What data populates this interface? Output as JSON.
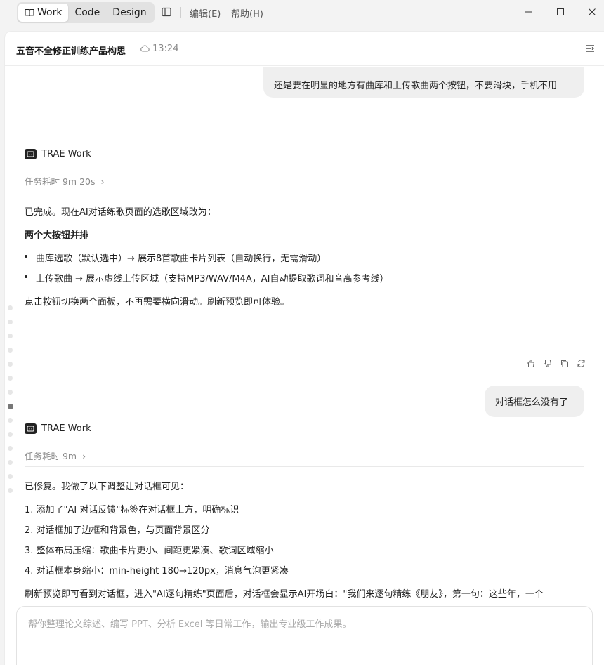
{
  "titlebar": {
    "modes": [
      "Work",
      "Code",
      "Design"
    ],
    "active_mode": "Work",
    "menus": [
      "编辑(E)",
      "帮助(H)"
    ]
  },
  "header": {
    "title": "五音不全修正训练产品构思",
    "time": "13:24"
  },
  "messages": {
    "user1": "还是要在明显的地方有曲库和上传歌曲两个按钮，不要滑块，手机不用",
    "agent1": {
      "name": "TRAE Work",
      "task_time": "任务耗时 9m 20s",
      "intro": "已完成。现在AI对话练歌页面的选歌区域改为：",
      "heading": "两个大按钮并排",
      "bullets": [
        "曲库选歌（默认选中）→ 展示8首歌曲卡片列表（自动换行，无需滑动）",
        "上传歌曲 → 展示虚线上传区域（支持MP3/WAV/M4A，AI自动提取歌词和音高参考线）"
      ],
      "outro": "点击按钮切换两个面板，不再需要横向滑动。刷新预览即可体验。"
    },
    "user2": "对话框怎么没有了",
    "agent2": {
      "name": "TRAE Work",
      "task_time": "任务耗时 9m",
      "intro": "已修复。我做了以下调整让对话框可见：",
      "items": [
        "1. 添加了\"AI 对话反馈\"标签在对话框上方，明确标识",
        "2. 对话框加了边框和背景色，与页面背景区分",
        "3. 整体布局压缩：歌曲卡片更小、间距更紧凑、歌词区域缩小",
        "4. 对话框本身缩小：min-height 180→120px，消息气泡更紧凑"
      ],
      "outro_partial": "刷新预览即可看到对话框，进入\"AI逐句精练\"页面后，对话框会显示AI开场白：\"我们来逐句精练《朋友》，第一句：这些年，一个"
    }
  },
  "composer": {
    "placeholder": "帮你整理论文综述、编写 PPT、分析 Excel 等日常工作，输出专业级工作成果。"
  }
}
